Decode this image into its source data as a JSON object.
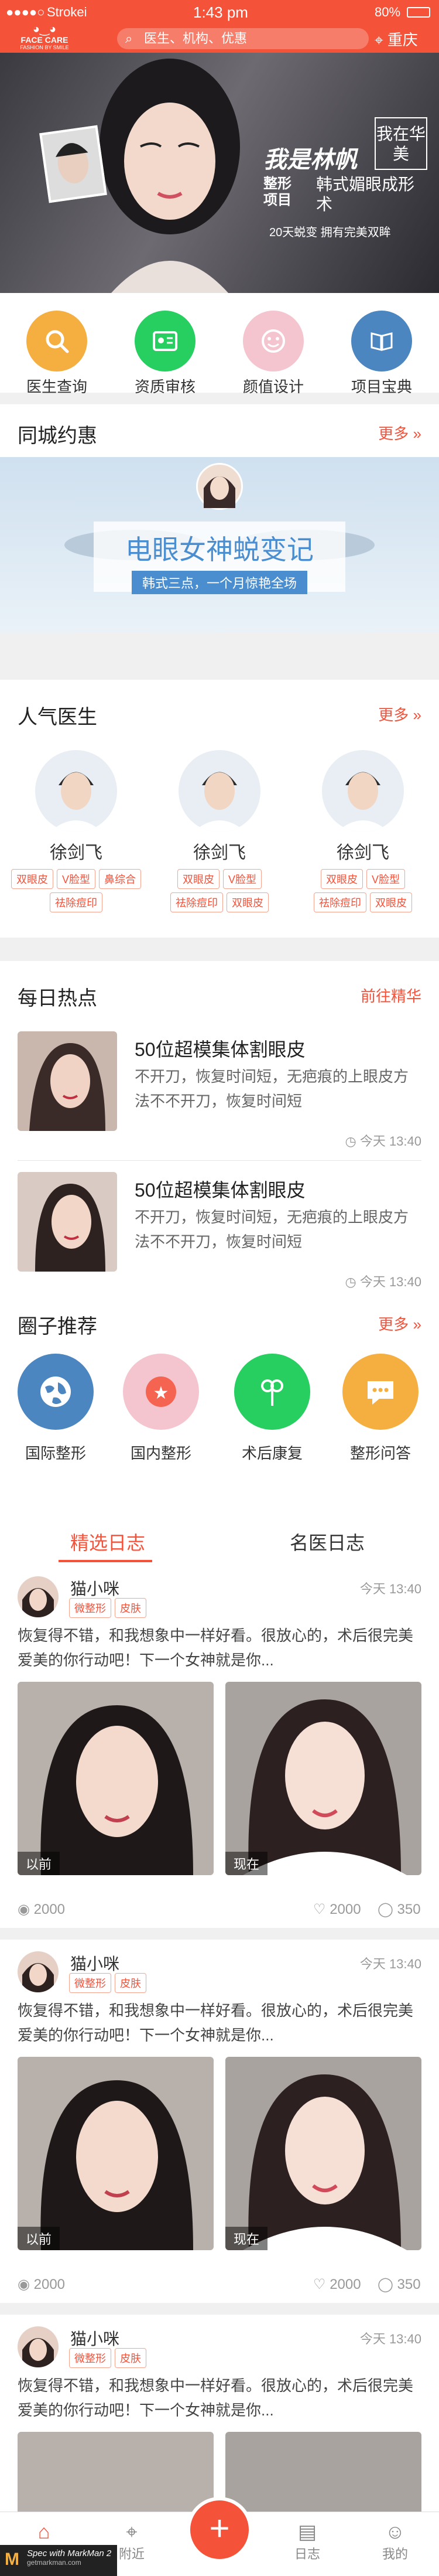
{
  "status_bar": {
    "carrier": "Strokei",
    "time": "1:43 pm",
    "battery": "80%"
  },
  "header": {
    "logo_text": "FACE CARE",
    "logo_sub": "FASHION BY SMILE",
    "search_placeholder": "医生、机构、优惠",
    "city": "重庆"
  },
  "banner": {
    "headline": "我是林帆",
    "tag1": "整形",
    "tag2": "项目",
    "subtitle": "韩式媚眼成形术",
    "badge": "我在华美",
    "caption": "20天蜕变 拥有完美双眸"
  },
  "quick_nav": [
    {
      "label": "医生查询",
      "icon": "search-icon",
      "color": "#f5af41"
    },
    {
      "label": "资质审核",
      "icon": "id-card-icon",
      "color": "#27ce60"
    },
    {
      "label": "颜值设计",
      "icon": "smile-face-icon",
      "color": "#f5c5cf"
    },
    {
      "label": "项目宝典",
      "icon": "book-icon",
      "color": "#4b86c0"
    }
  ],
  "nearby": {
    "title": "同城约惠",
    "more": "更多",
    "promo_title": "电眼女神蜕变记",
    "promo_sub": "韩式三点，一个月惊艳全场"
  },
  "doctors": {
    "title": "人气医生",
    "more": "更多",
    "items": [
      {
        "name": "徐剑飞",
        "tags": [
          "双眼皮",
          "V脸型",
          "鼻综合",
          "祛除痘印"
        ]
      },
      {
        "name": "徐剑飞",
        "tags": [
          "双眼皮",
          "V脸型",
          "祛除痘印",
          "双眼皮"
        ]
      },
      {
        "name": "徐剑飞",
        "tags": [
          "双眼皮",
          "V脸型",
          "祛除痘印",
          "双眼皮"
        ]
      }
    ]
  },
  "daily_hot": {
    "title": "每日热点",
    "more": "前往精华",
    "items": [
      {
        "title": "50位超模集体割眼皮",
        "text": "不开刀，恢复时间短，无疤痕的上眼皮方法不不开刀，恢复时间短",
        "time": "今天 13:40"
      },
      {
        "title": "50位超模集体割眼皮",
        "text": "不开刀，恢复时间短，无疤痕的上眼皮方法不不开刀，恢复时间短",
        "time": "今天 13:40"
      }
    ]
  },
  "circles": {
    "title": "圈子推荐",
    "more": "更多",
    "items": [
      {
        "label": "国际整形",
        "icon": "globe-icon",
        "color": "#4b86c0"
      },
      {
        "label": "国内整形",
        "icon": "stars-icon",
        "color": "#f5c5cf"
      },
      {
        "label": "术后康复",
        "icon": "flower-icon",
        "color": "#27ce60"
      },
      {
        "label": "整形问答",
        "icon": "chat-bubble-icon",
        "color": "#f5af41"
      }
    ]
  },
  "diary_tabs": {
    "active": "精选日志",
    "other": "名医日志"
  },
  "diaries": [
    {
      "user": "猫小咪",
      "tags": [
        "微整形",
        "皮肤"
      ],
      "time": "今天 13:40",
      "text": "恢复得不错，和我想象中一样好看。很放心的，术后很完美爱美的你行动吧！下一个女神就是你...",
      "before": "以前",
      "after": "现在",
      "views": "2000",
      "likes": "2000",
      "comments": "350"
    },
    {
      "user": "猫小咪",
      "tags": [
        "微整形",
        "皮肤"
      ],
      "time": "今天 13:40",
      "text": "恢复得不错，和我想象中一样好看。很放心的，术后很完美爱美的你行动吧！下一个女神就是你...",
      "before": "以前",
      "after": "现在",
      "views": "2000",
      "likes": "2000",
      "comments": "350"
    },
    {
      "user": "猫小咪",
      "tags": [
        "微整形",
        "皮肤"
      ],
      "time": "今天 13:40",
      "text": "恢复得不错，和我想象中一样好看。很放心的，术后很完美爱美的你行动吧！下一个女神就是你..."
    }
  ],
  "tab_bar": [
    {
      "label": "首页",
      "icon": "home-icon"
    },
    {
      "label": "附近",
      "icon": "location-pin-icon"
    },
    {
      "label": "",
      "icon": "plus-icon"
    },
    {
      "label": "日志",
      "icon": "diary-icon"
    },
    {
      "label": "我的",
      "icon": "user-icon"
    }
  ],
  "watermark": {
    "line1": "Spec with MarkMan 2",
    "line2": "getmarkman.com"
  },
  "colors": {
    "accent": "#f5523a",
    "orange": "#f5af41",
    "green": "#27ce60",
    "blue": "#4b86c0",
    "pink": "#f5c5cf"
  }
}
